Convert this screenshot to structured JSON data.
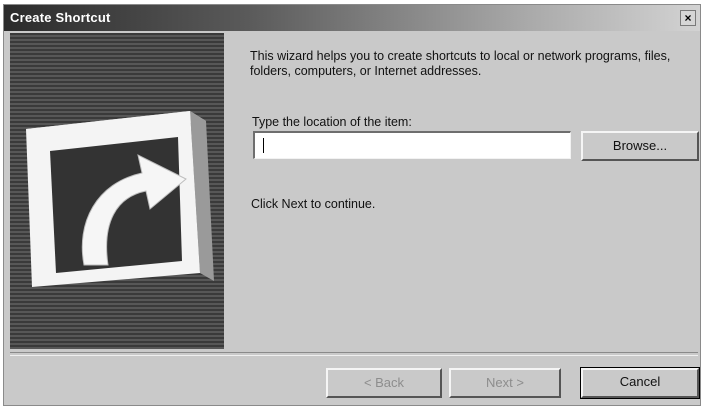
{
  "window": {
    "title": "Create Shortcut",
    "close_glyph": "×"
  },
  "wizard": {
    "intro_text": "This wizard helps you to create shortcuts to local or network programs, files, folders, computers, or Internet addresses.",
    "location_label": "Type the location of the item:",
    "location_value": "",
    "browse_label": "Browse...",
    "continue_text": "Click Next to continue."
  },
  "footer": {
    "back_label": "< Back",
    "next_label": "Next >",
    "cancel_label": "Cancel"
  },
  "graphic": {
    "icon": "shortcut-arrow-icon"
  }
}
